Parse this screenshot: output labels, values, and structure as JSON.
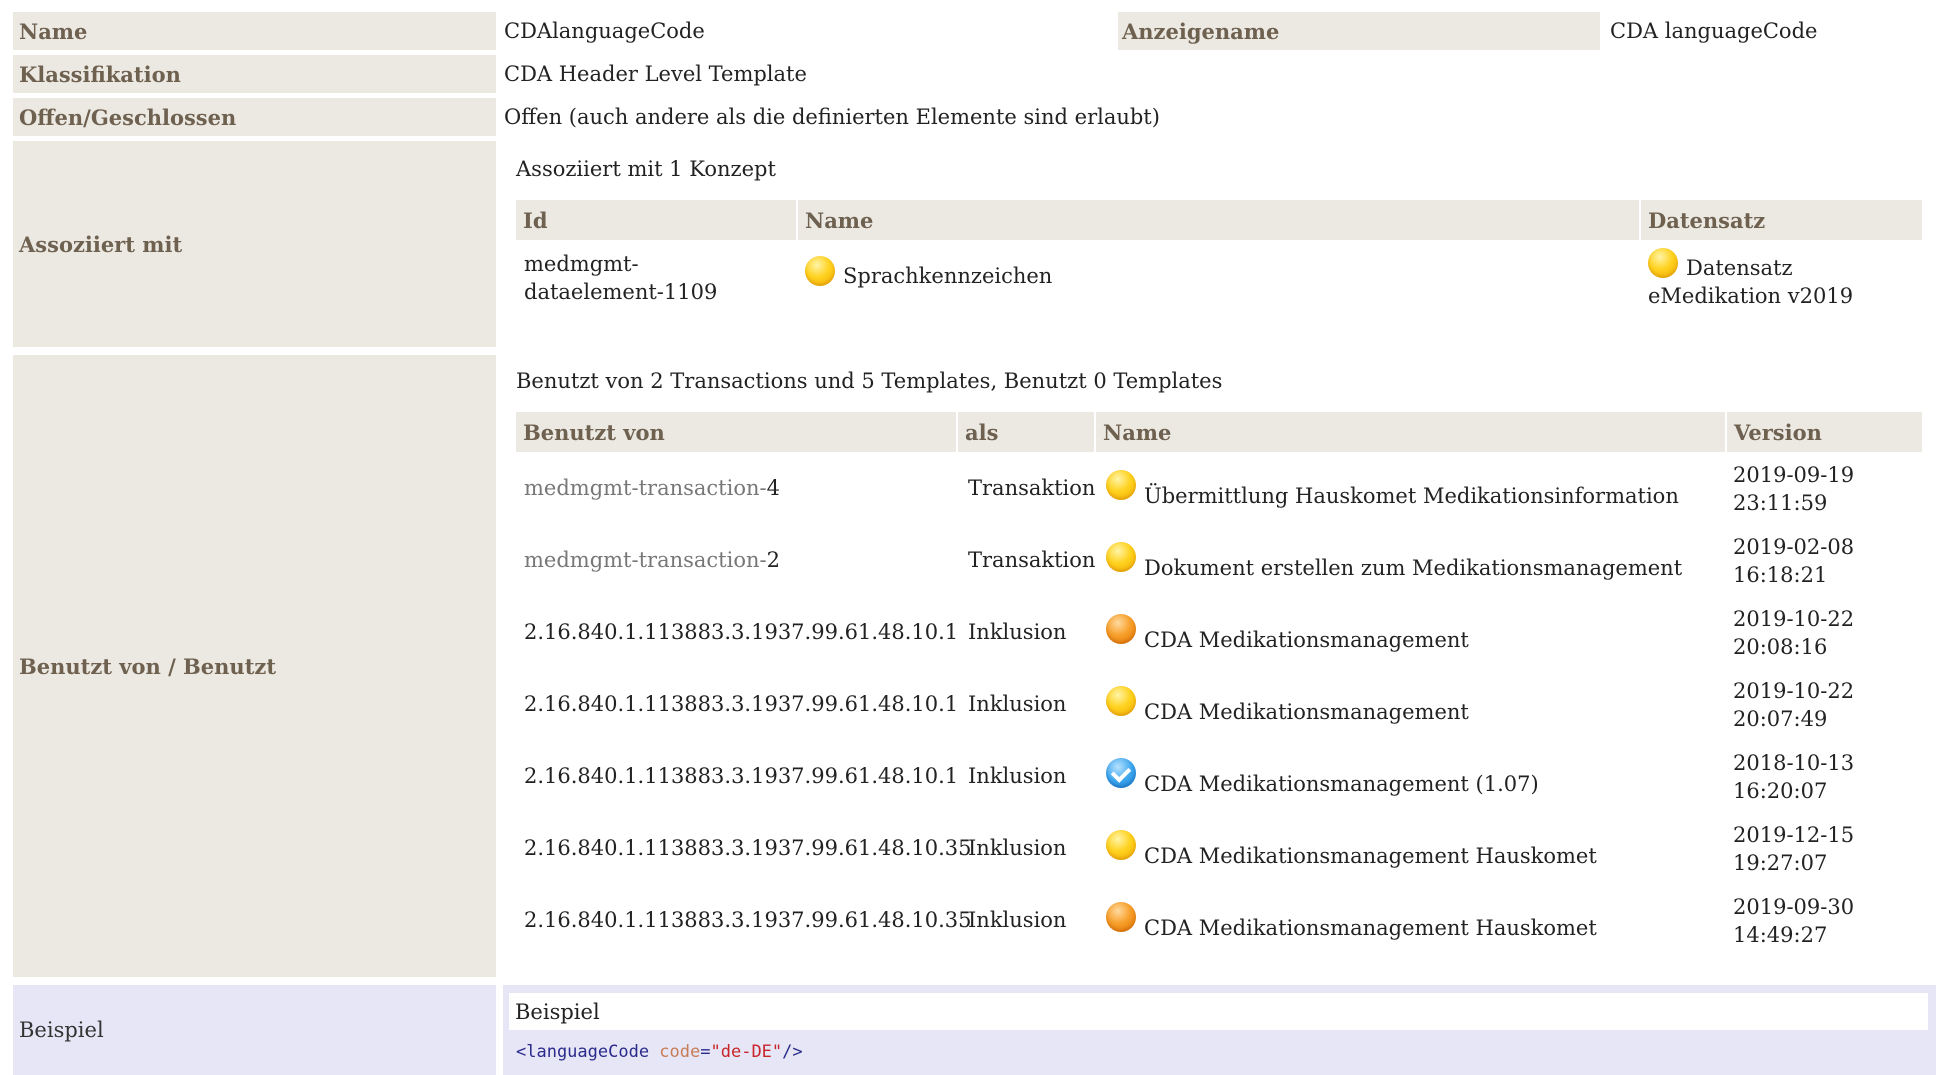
{
  "header": {
    "name_label": "Name",
    "name_value": "CDAlanguageCode",
    "display_label": "Anzeigename",
    "display_value": "CDA languageCode",
    "klass_label": "Klassifikation",
    "klass_value": "CDA Header Level Template",
    "open_label": "Offen/Geschlossen",
    "open_value": "Offen (auch andere als die definierten Elemente sind erlaubt)"
  },
  "associated": {
    "label": "Assoziiert mit",
    "caption": "Assoziiert mit 1 Konzept",
    "columns": [
      "Id",
      "Name",
      "Datensatz"
    ],
    "rows": [
      {
        "id_line1": "medmgmt-",
        "id_line2": "dataelement-1109",
        "name": "Sprachkennzeichen",
        "name_status": "yellow",
        "dataset_line1": "Datensatz",
        "dataset_line2": "eMedikation v2019",
        "dataset_status": "yellow"
      }
    ]
  },
  "usage": {
    "label": "Benutzt von / Benutzt",
    "caption": "Benutzt von 2 Transactions und 5 Templates, Benutzt 0 Templates",
    "columns": [
      "Benutzt von",
      "als",
      "Name",
      "Version"
    ],
    "rows": [
      {
        "id_prefix": "medmgmt-transaction-",
        "id_suffix": "4",
        "as": "Transaktion",
        "status": "yellow",
        "name": "Übermittlung Hauskomet Medikationsinformation",
        "date": "2019-09-19",
        "time": "23:11:59"
      },
      {
        "id_prefix": "medmgmt-transaction-",
        "id_suffix": "2",
        "as": "Transaktion",
        "status": "yellow",
        "name": "Dokument erstellen zum Medikationsmanagement",
        "date": "2019-02-08",
        "time": "16:18:21"
      },
      {
        "id_prefix": "",
        "id_suffix": "2.16.840.1.113883.3.1937.99.61.48.10.1",
        "as": "Inklusion",
        "status": "orange",
        "name": "CDA Medikationsmanagement",
        "date": "2019-10-22",
        "time": "20:08:16"
      },
      {
        "id_prefix": "",
        "id_suffix": "2.16.840.1.113883.3.1937.99.61.48.10.1",
        "as": "Inklusion",
        "status": "yellow",
        "name": "CDA Medikationsmanagement",
        "date": "2019-10-22",
        "time": "20:07:49"
      },
      {
        "id_prefix": "",
        "id_suffix": "2.16.840.1.113883.3.1937.99.61.48.10.1",
        "as": "Inklusion",
        "status": "blue",
        "name": "CDA Medikationsmanagement (1.07)",
        "date": "2018-10-13",
        "time": "16:20:07"
      },
      {
        "id_prefix": "",
        "id_suffix": "2.16.840.1.113883.3.1937.99.61.48.10.35",
        "as": "Inklusion",
        "status": "yellow",
        "name": "CDA Medikationsmanagement Hauskomet",
        "date": "2019-12-15",
        "time": "19:27:07"
      },
      {
        "id_prefix": "",
        "id_suffix": "2.16.840.1.113883.3.1937.99.61.48.10.35",
        "as": "Inklusion",
        "status": "orange",
        "name": "CDA Medikationsmanagement Hauskomet",
        "date": "2019-09-30",
        "time": "14:49:27"
      }
    ]
  },
  "example": {
    "label": "Beispiel",
    "title": "Beispiel",
    "code_open": "<languageCode ",
    "code_attr": "code",
    "code_eq": "=",
    "code_value": "\"de-DE\"",
    "code_close": "/>"
  },
  "colors": {
    "label_bg": "#ece9e3",
    "label_text": "#6f6150",
    "example_bg": "#e6e6f6",
    "status_yellow": "#ffd21f",
    "status_orange": "#f7a02b",
    "status_blue": "#3da7ee"
  }
}
